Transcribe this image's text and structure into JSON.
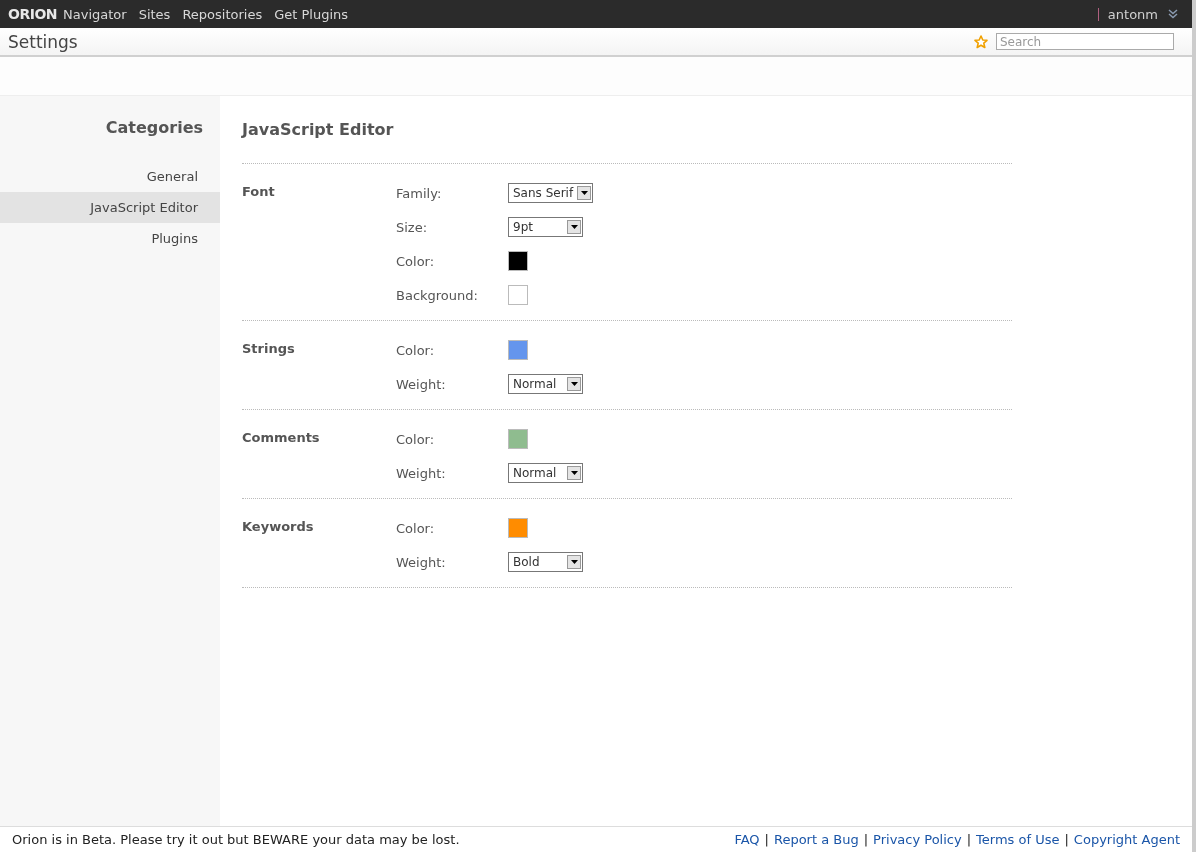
{
  "top_bar": {
    "logo": "ORION",
    "nav": [
      "Navigator",
      "Sites",
      "Repositories",
      "Get Plugins"
    ],
    "user": "antonm"
  },
  "title_bar": {
    "title": "Settings",
    "search": {
      "placeholder": "Search"
    }
  },
  "sidebar": {
    "heading": "Categories",
    "items": [
      {
        "label": "General",
        "selected": false
      },
      {
        "label": "JavaScript Editor",
        "selected": true
      },
      {
        "label": "Plugins",
        "selected": false
      }
    ]
  },
  "content": {
    "heading": "JavaScript Editor",
    "sections": [
      {
        "title": "Font",
        "fields": [
          {
            "kind": "select",
            "label": "Family:",
            "value": "Sans Serif"
          },
          {
            "kind": "select",
            "label": "Size:",
            "value": "9pt"
          },
          {
            "kind": "color",
            "label": "Color:",
            "color": "#000000"
          },
          {
            "kind": "color",
            "label": "Background:",
            "color": "#ffffff"
          }
        ]
      },
      {
        "title": "Strings",
        "fields": [
          {
            "kind": "color",
            "label": "Color:",
            "color": "#6495ed"
          },
          {
            "kind": "select",
            "label": "Weight:",
            "value": "Normal"
          }
        ]
      },
      {
        "title": "Comments",
        "fields": [
          {
            "kind": "color",
            "label": "Color:",
            "color": "#8fbc8f"
          },
          {
            "kind": "select",
            "label": "Weight:",
            "value": "Normal"
          }
        ]
      },
      {
        "title": "Keywords",
        "fields": [
          {
            "kind": "color",
            "label": "Color:",
            "color": "#ff8c00"
          },
          {
            "kind": "select",
            "label": "Weight:",
            "value": "Bold"
          }
        ]
      }
    ]
  },
  "footer": {
    "notice": "Orion is in Beta. Please try it out but BEWARE your data may be lost.",
    "links": [
      {
        "kind": "link",
        "text": "FAQ"
      },
      {
        "kind": "separator",
        "text": "|"
      },
      {
        "kind": "link",
        "text": "Report a Bug"
      },
      {
        "kind": "separator",
        "text": "|"
      },
      {
        "kind": "link",
        "text": "Privacy Policy"
      },
      {
        "kind": "separator",
        "text": "|"
      },
      {
        "kind": "link",
        "text": "Terms of Use"
      },
      {
        "kind": "separator",
        "text": "|"
      },
      {
        "kind": "link",
        "text": "Copyright Agent"
      }
    ]
  }
}
